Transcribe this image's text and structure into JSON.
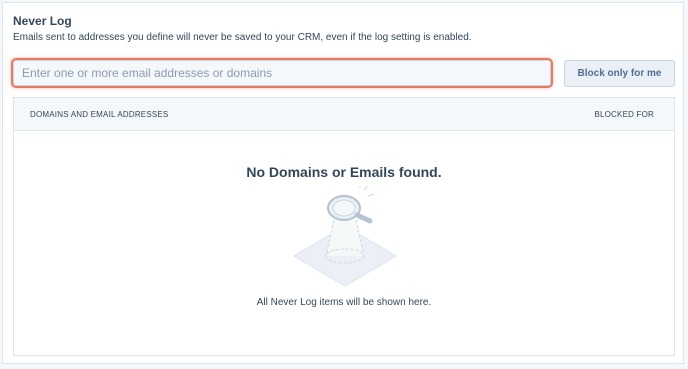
{
  "section": {
    "title": "Never Log",
    "description": "Emails sent to addresses you define will never be saved to your CRM, even if the log setting is enabled."
  },
  "email_input": {
    "placeholder": "Enter one or more email addresses or domains",
    "value": ""
  },
  "block_button": {
    "label": "Block only for me"
  },
  "table": {
    "columns": [
      "DOMAINS AND EMAIL ADDRESSES",
      "BLOCKED FOR"
    ],
    "empty_title": "No Domains or Emails found.",
    "empty_note": "All Never Log items will be shown here.",
    "empty_illustration_icon": "magnifying-glass-spotlight-icon"
  },
  "colors": {
    "focus_ring": "#e87a5f",
    "text": "#33475b",
    "button_bg": "#eaf0f6",
    "border": "#dfe3eb"
  }
}
